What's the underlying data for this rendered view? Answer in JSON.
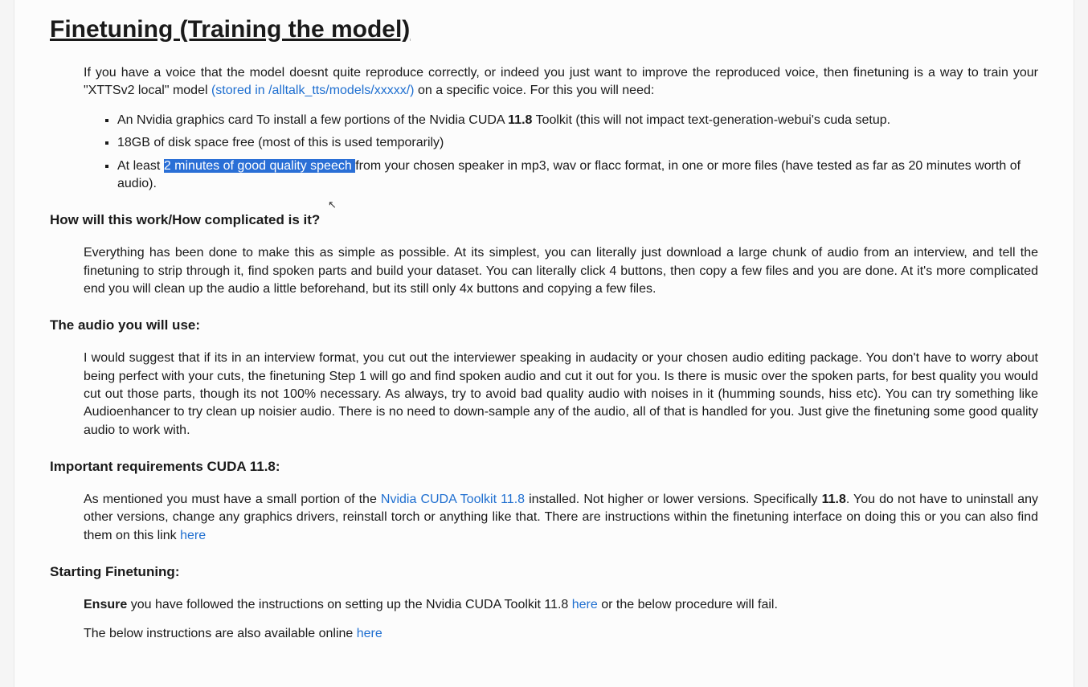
{
  "title": "Finetuning (Training the model)",
  "intro": {
    "part1": "If you have a voice that the model doesnt quite reproduce correctly, or indeed you just want to improve the reproduced voice, then finetuning is a way to train your \"XTTSv2 local\" model ",
    "link_text": "(stored in /alltalk_tts/models/xxxxx/)",
    "part2": " on a specific voice. For this you will need:"
  },
  "req1": {
    "a": "An Nvidia graphics card To install a few portions of the Nvidia CUDA ",
    "b": "11.8",
    "c": " Toolkit (this will not impact text-generation-webui's cuda setup."
  },
  "req2": "18GB of disk space free (most of this is used temporarily)",
  "req3": {
    "a": "At least ",
    "hl": "2 minutes of good quality speech ",
    "b": "from your chosen speaker in mp3, wav or flacc format, in one or more files (have tested as far as 20 minutes worth of audio)."
  },
  "sec1": {
    "h": "How will this work/How complicated is it?",
    "p": "Everything has been done to make this as simple as possible. At its simplest, you can literally just download a large chunk of audio from an interview, and tell the finetuning to strip through it, find spoken parts and build your dataset. You can literally click 4 buttons, then copy a few files and you are done. At it's more complicated end you will clean up the audio a little beforehand, but its still only 4x buttons and copying a few files."
  },
  "sec2": {
    "h": "The audio you will use:",
    "p": "I would suggest that if its in an interview format, you cut out the interviewer speaking in audacity or your chosen audio editing package. You don't have to worry about being perfect with your cuts, the finetuning Step 1 will go and find spoken audio and cut it out for you. Is there is music over the spoken parts, for best quality you would cut out those parts, though its not 100% necessary. As always, try to avoid bad quality audio with noises in it (humming sounds, hiss etc). You can try something like Audioenhancer to try clean up noisier audio. There is no need to down-sample any of the audio, all of that is handled for you. Just give the finetuning some good quality audio to work with."
  },
  "sec3": {
    "h": "Important requirements CUDA 11.8:",
    "p_a": "As mentioned you must have a small portion of the ",
    "p_link1": "Nvidia CUDA Toolkit 11.8",
    "p_b": " installed. Not higher or lower versions. Specifically ",
    "p_bold": "11.8",
    "p_c": ". You do not have to uninstall any other versions, change any graphics drivers, reinstall torch or anything like that. There are instructions within the finetuning interface on doing this or you can also find them on this link ",
    "p_link2": "here"
  },
  "sec4": {
    "h": "Starting Finetuning:",
    "p1_bold": "Ensure",
    "p1_a": " you have followed the instructions on setting up the Nvidia CUDA Toolkit 11.8 ",
    "p1_link": "here",
    "p1_b": " or the below procedure will fail.",
    "p2_a": "The below instructions are also available online ",
    "p2_link": "here"
  }
}
